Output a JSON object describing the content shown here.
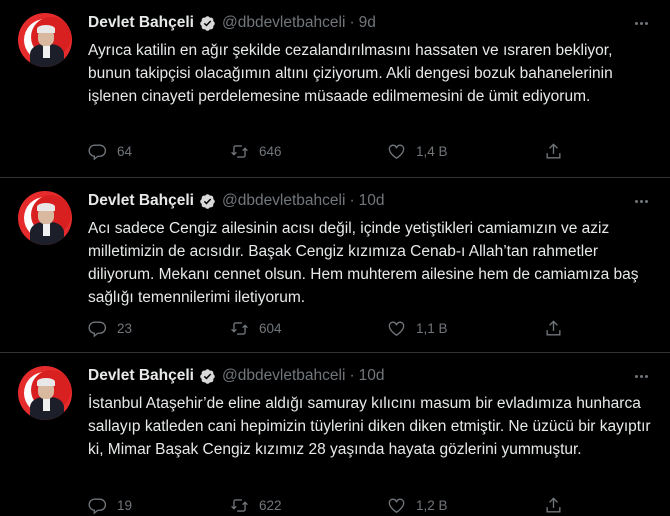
{
  "tweets": [
    {
      "name": "Devlet Bahçeli",
      "handle": "@dbdevletbahceli",
      "separator": "·",
      "time": "9d",
      "text": "Ayrıca katilin en ağır şekilde cezalandırılmasını hassaten ve ısraren bekliyor, bunun takipçisi olacağımın altını çiziyorum. Akli dengesi bozuk bahanelerinin işlenen cinayeti perdelemesine müsaade edilmemesini de ümit ediyorum.",
      "replies": "64",
      "retweets": "646",
      "likes": "1,4 B"
    },
    {
      "name": "Devlet Bahçeli",
      "handle": "@dbdevletbahceli",
      "separator": "·",
      "time": "10d",
      "text": "Acı sadece Cengiz ailesinin acısı değil, içinde yetiştikleri camiamızın ve aziz milletimizin de acısıdır. Başak Cengiz kızımıza Cenab-ı Allah’tan rahmetler diliyorum. Mekanı cennet olsun. Hem muhterem ailesine hem de camiamıza baş sağlığı temennilerimi iletiyorum.",
      "replies": "23",
      "retweets": "604",
      "likes": "1,1 B"
    },
    {
      "name": "Devlet Bahçeli",
      "handle": "@dbdevletbahceli",
      "separator": "·",
      "time": "10d",
      "text": "İstanbul Ataşehir’de eline aldığı samuray kılıcını masum bir evladımıza hunharca sallayıp katleden cani hepimizin tüylerini diken diken etmiştir. Ne üzücü bir kayıptır ki, Mimar Başak Cengiz kızımız 28 yaşında hayata gözlerini yummuştur.",
      "replies": "19",
      "retweets": "622",
      "likes": "1,2 B"
    }
  ],
  "icons": {
    "reply": "reply-icon",
    "retweet": "retweet-icon",
    "like": "heart-icon",
    "share": "share-icon",
    "verified": "verified-badge-icon",
    "more": "more-options-icon"
  },
  "colors": {
    "background": "#000000",
    "text": "#e7e9ea",
    "secondary": "#71767b",
    "divider": "#2f3336"
  }
}
